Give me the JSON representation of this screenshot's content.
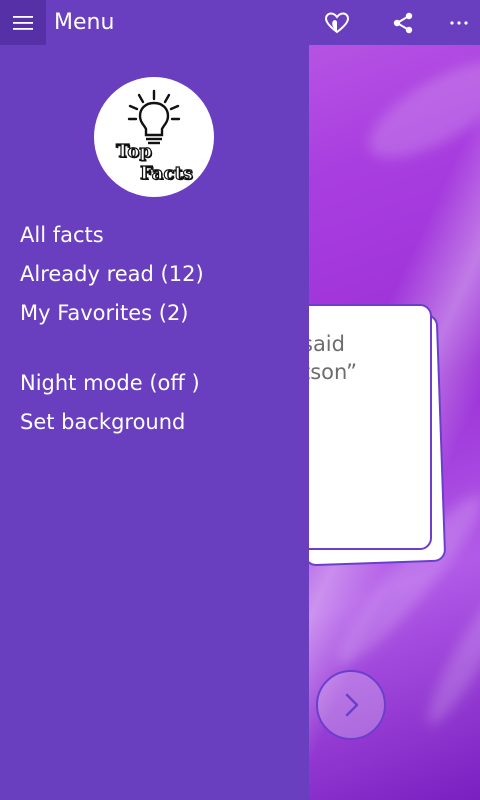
{
  "header": {
    "title": "Menu",
    "icons": [
      "hamburger-icon",
      "heart-icon",
      "share-icon",
      "more-icon"
    ]
  },
  "drawer": {
    "logo": {
      "line1": "Top",
      "line2": "Facts"
    },
    "items": [
      {
        "label": "All facts"
      },
      {
        "label": "Already read (12)"
      },
      {
        "label": "My Favorites (2)"
      },
      {
        "label": "Night mode (off )"
      },
      {
        "label": "Set background"
      }
    ]
  },
  "card": {
    "visible_text": "said\ntson”"
  },
  "colors": {
    "primary": "#6a3fbf",
    "primary_dark": "#5630a6",
    "card_border": "#6b3fcb"
  }
}
